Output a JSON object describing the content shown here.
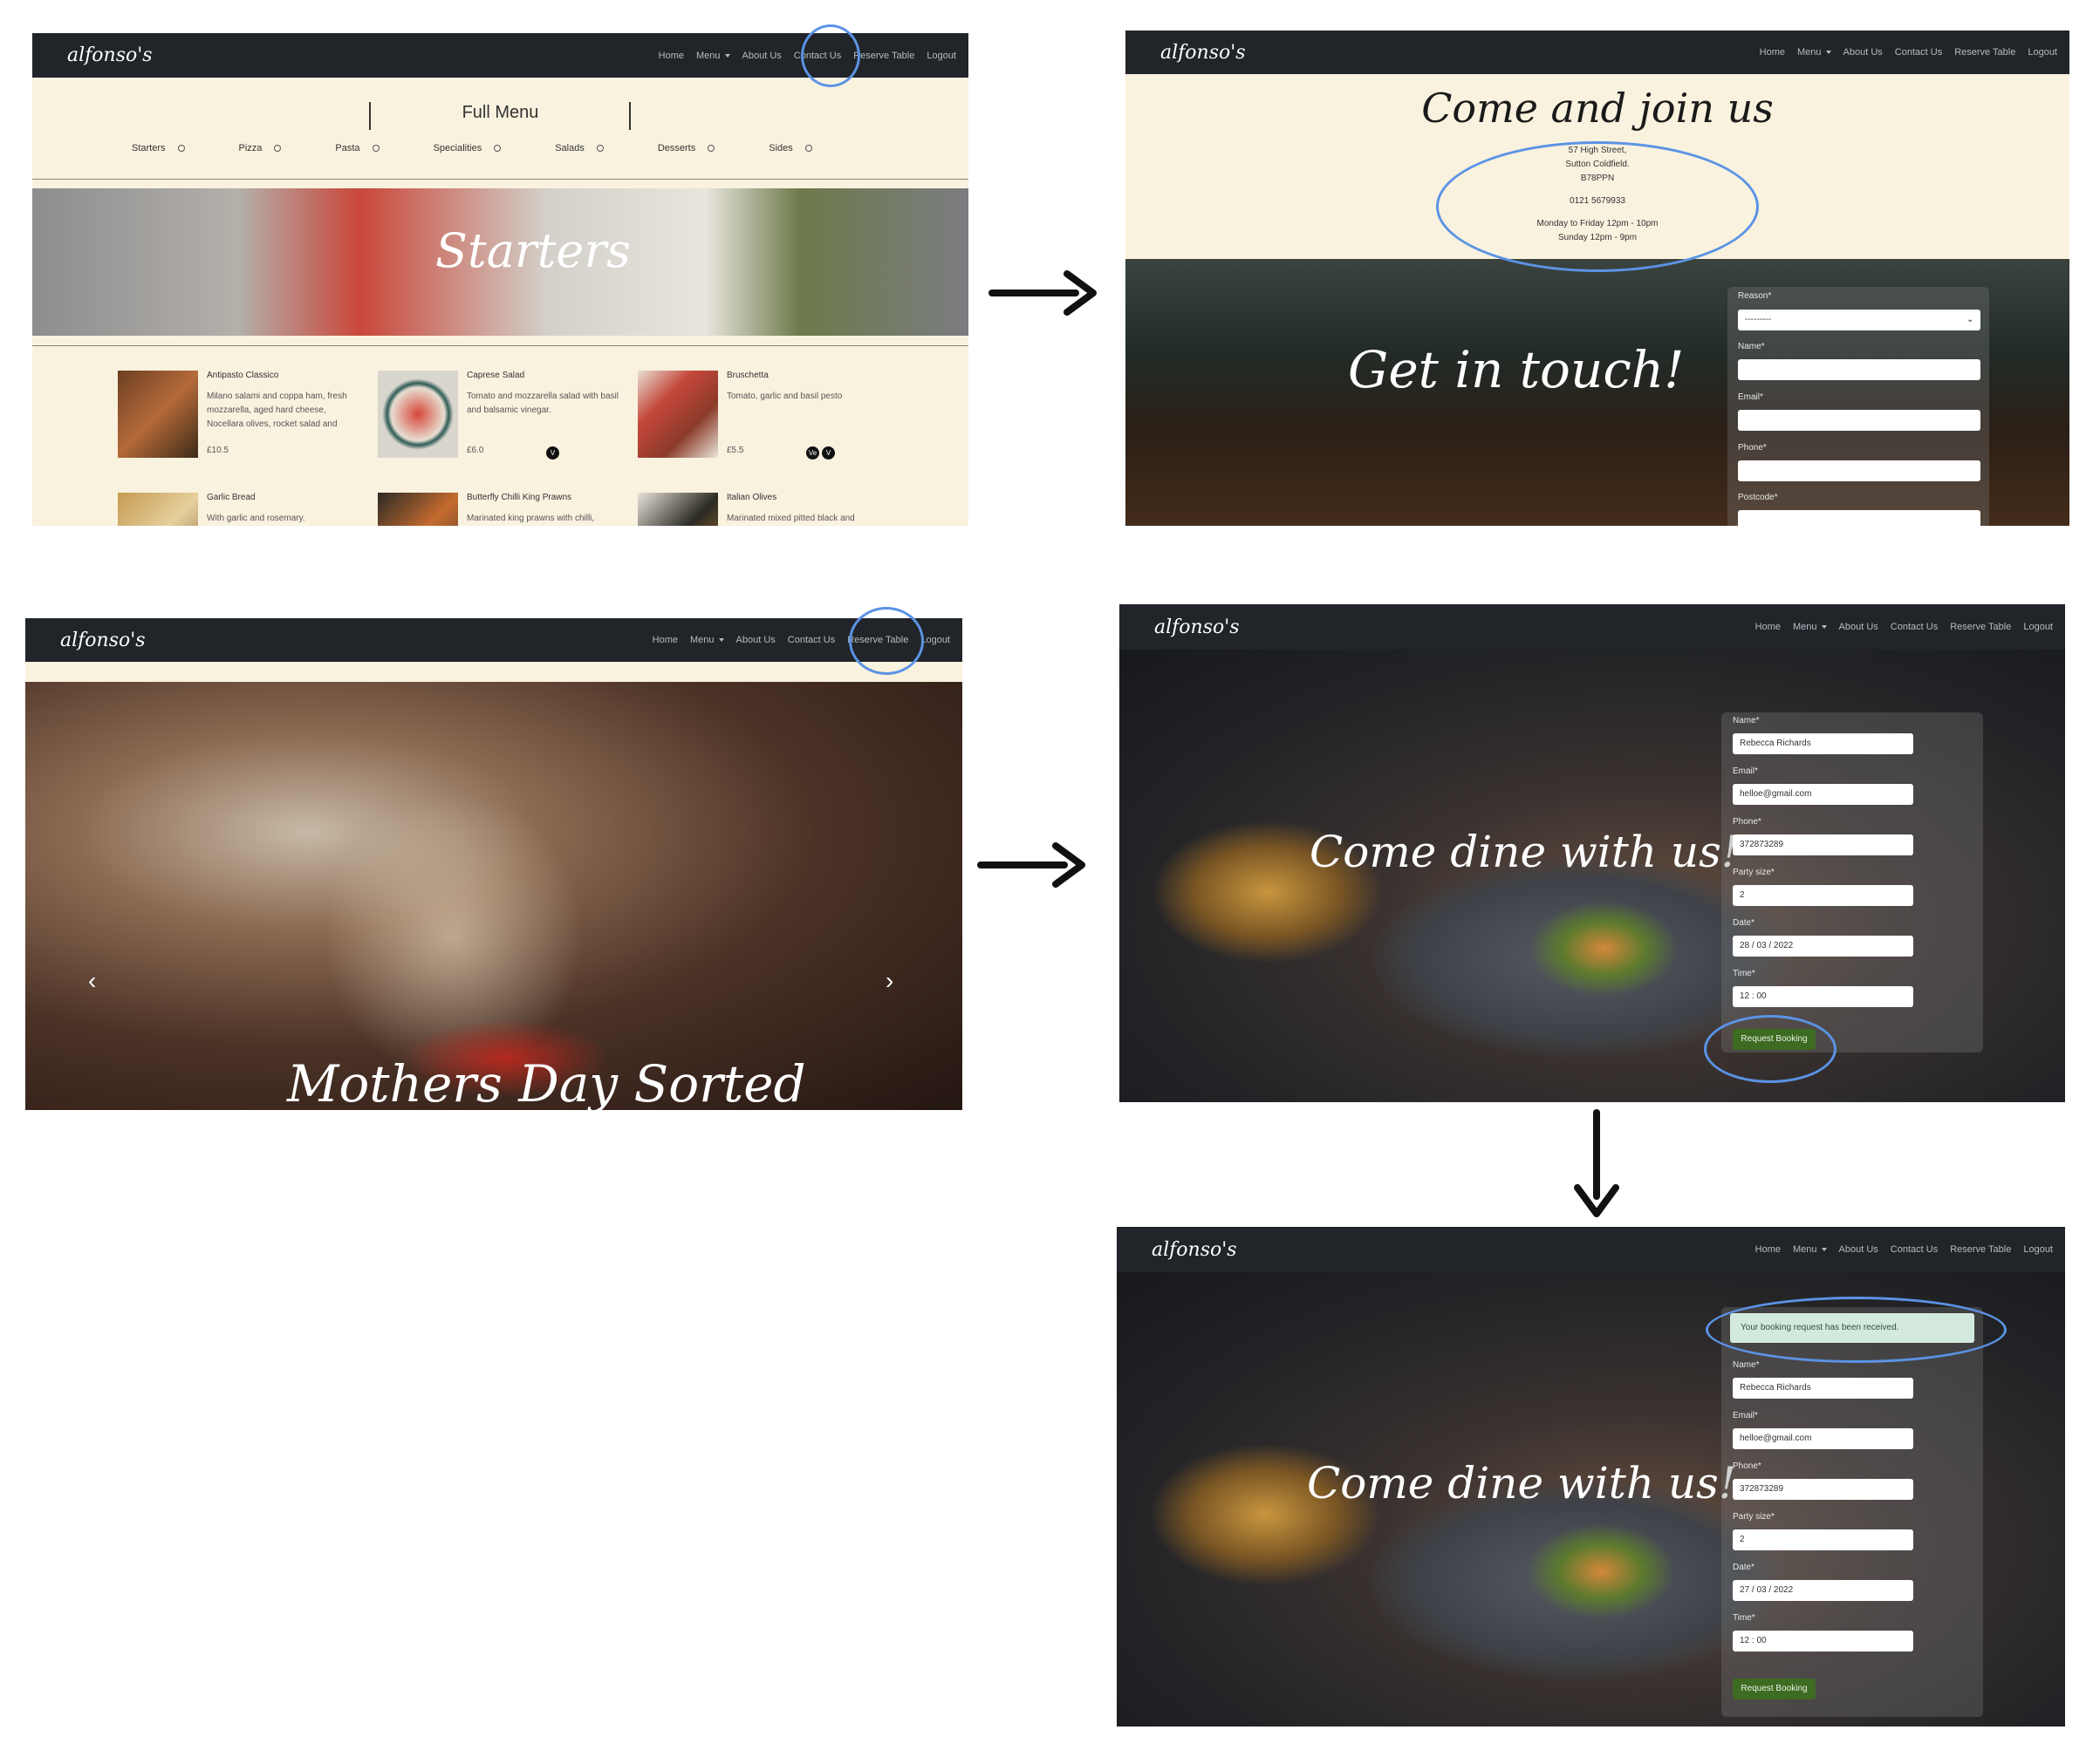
{
  "nav": {
    "logo": "alfonso's",
    "links": [
      "Home",
      "Menu",
      "About Us",
      "Contact Us",
      "Reserve Table",
      "Logout"
    ]
  },
  "menu_page": {
    "heading": "Full Menu",
    "categories": [
      "Starters",
      "Pizza",
      "Pasta",
      "Specialities",
      "Salads",
      "Desserts",
      "Sides"
    ],
    "banner_title": "Starters",
    "items": [
      {
        "name": "Antipasto Classico",
        "desc": "Milano salami and coppa ham, fresh mozzarella, aged hard cheese, Nocellara olives, rocket salad and",
        "price": "£10.5",
        "badges": []
      },
      {
        "name": "Caprese Salad",
        "desc": "Tomato and mozzarella salad with basil and balsamic vinegar.",
        "price": "£6.0",
        "badges": [
          "V"
        ]
      },
      {
        "name": "Bruschetta",
        "desc": "Tomato, garlic and basil pesto",
        "price": "£5.5",
        "badges": [
          "Ve",
          "V"
        ]
      },
      {
        "name": "Garlic Bread",
        "desc": "With garlic and rosemary.",
        "price": "",
        "badges": []
      },
      {
        "name": "Butterfly Chilli King Prawns",
        "desc": "Marinated king prawns with chilli,",
        "price": "",
        "badges": []
      },
      {
        "name": "Italian Olives",
        "desc": "Marinated mixed pitted black and",
        "price": "",
        "badges": []
      }
    ]
  },
  "contact_page": {
    "heading": "Come and join us",
    "address_lines": [
      "57 High Street,",
      "Sutton Coldfield.",
      "B78PPN"
    ],
    "phone": "0121 5679933",
    "hours": [
      "Monday to Friday 12pm - 10pm",
      "Sunday 12pm - 9pm"
    ],
    "hero_title": "Get in touch!",
    "form": {
      "reason_label": "Reason*",
      "reason_value": "---------",
      "name_label": "Name*",
      "email_label": "Email*",
      "phone_label": "Phone*",
      "postcode_label": "Postcode*"
    }
  },
  "home_page": {
    "carousel_caption": "Mothers Day Sorted",
    "prev_arrow": "‹",
    "next_arrow": "›"
  },
  "booking_page": {
    "hero_title": "Come dine with us!",
    "labels": {
      "name": "Name*",
      "email": "Email*",
      "phone": "Phone*",
      "party": "Party size*",
      "date": "Date*",
      "time": "Time*"
    },
    "values": {
      "name": "Rebecca Richards",
      "email": "helloe@gmail.com",
      "phone": "372873289",
      "party": "2",
      "date": "28 / 03 / 2022",
      "time": "12 : 00"
    },
    "button": "Request Booking"
  },
  "booking_confirmed": {
    "alert": "Your booking request has been received.",
    "date": "27 / 03 / 2022"
  },
  "colors": {
    "nav_bg": "#212429",
    "cream": "#f9f2df",
    "highlight_ring": "#5b93e5",
    "button_green": "#3d6b22",
    "alert_bg": "#d3e9de"
  }
}
